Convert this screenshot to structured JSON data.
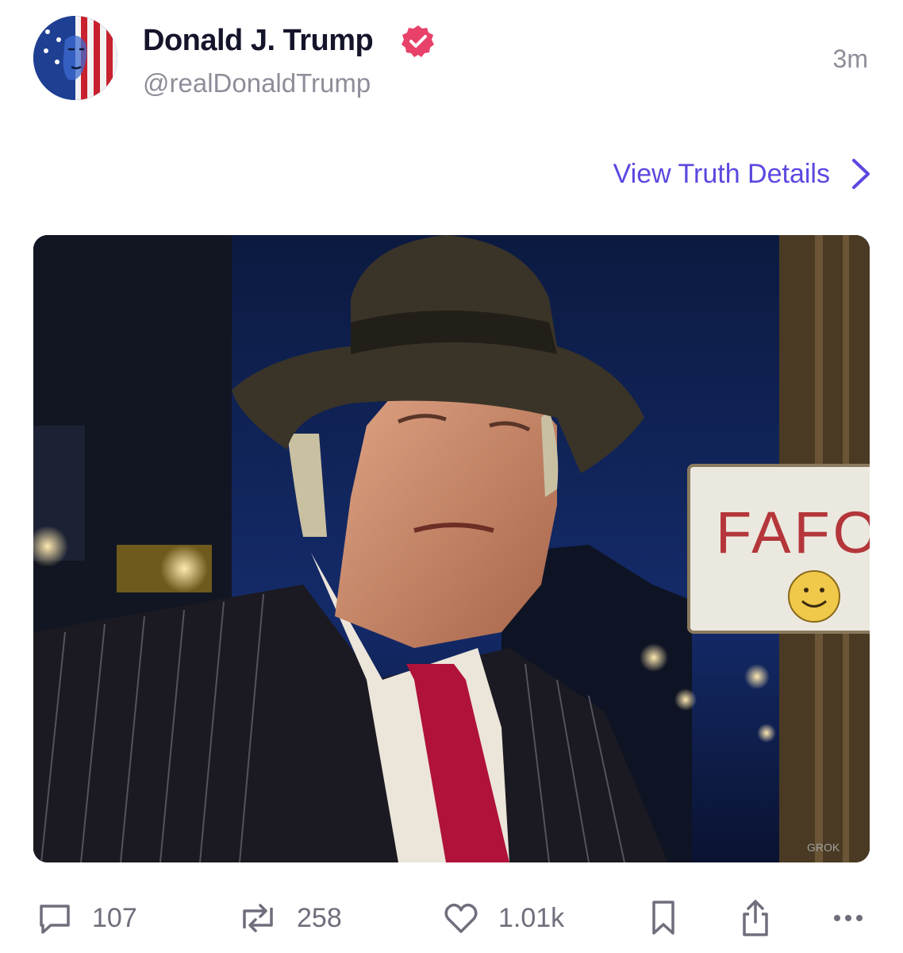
{
  "post": {
    "author": {
      "display_name": "Donald J. Trump",
      "handle": "@realDonaldTrump",
      "verified": true,
      "avatar_icon": "avatar-flag-face"
    },
    "timestamp": "3m",
    "details_link_label": "View Truth Details",
    "image": {
      "sign_text": "FAFO",
      "watermark_text": "GROK"
    },
    "actions": {
      "replies": "107",
      "retruths": "258",
      "likes": "1.01k"
    }
  },
  "colors": {
    "accent": "#5a48e0",
    "verified_badge": "#e8416a",
    "muted_text": "#8e8e9a",
    "icon_gray": "#6e6e7c"
  }
}
